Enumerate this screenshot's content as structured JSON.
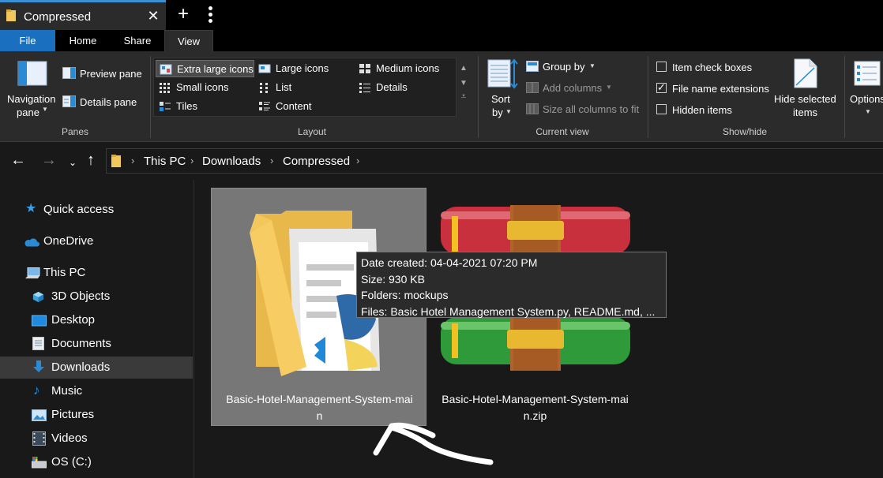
{
  "window": {
    "tab_title": "Compressed",
    "close_glyph": "✕",
    "new_tab_glyph": "+"
  },
  "ribbon_tabs": [
    "File",
    "Home",
    "Share",
    "View"
  ],
  "ribbon": {
    "panes": {
      "navigation_pane": "Navigation pane",
      "navigation_line1": "Navigation",
      "navigation_line2": "pane",
      "preview_pane": "Preview pane",
      "details_pane": "Details pane",
      "label": "Panes"
    },
    "layout": {
      "items": [
        "Extra large icons",
        "Large icons",
        "Medium icons",
        "Small icons",
        "List",
        "Details",
        "Tiles",
        "Content"
      ],
      "selected": "Extra large icons",
      "label": "Layout"
    },
    "current_view": {
      "sort_line1": "Sort",
      "sort_line2": "by",
      "group_by": "Group by",
      "add_columns": "Add columns",
      "size_all_columns": "Size all columns to fit",
      "label": "Current view"
    },
    "show_hide": {
      "item_check_boxes": "Item check boxes",
      "item_check_boxes_checked": false,
      "file_name_extensions": "File name extensions",
      "file_name_extensions_checked": true,
      "hidden_items": "Hidden items",
      "hidden_items_checked": false,
      "hide_selected_line1": "Hide selected",
      "hide_selected_line2": "items",
      "label": "Show/hide"
    },
    "options": {
      "label": "Options"
    }
  },
  "address": {
    "crumbs": [
      "This PC",
      "Downloads",
      "Compressed"
    ]
  },
  "sidebar": {
    "items": [
      {
        "label": "Quick access",
        "icon": "star-icon"
      },
      {
        "label": "OneDrive",
        "icon": "cloud-icon"
      },
      {
        "label": "This PC",
        "icon": "computer-icon"
      },
      {
        "label": "3D Objects",
        "icon": "cube-icon"
      },
      {
        "label": "Desktop",
        "icon": "desktop-icon"
      },
      {
        "label": "Documents",
        "icon": "documents-icon"
      },
      {
        "label": "Downloads",
        "icon": "download-icon"
      },
      {
        "label": "Music",
        "icon": "music-icon"
      },
      {
        "label": "Pictures",
        "icon": "pictures-icon"
      },
      {
        "label": "Videos",
        "icon": "videos-icon"
      },
      {
        "label": "OS (C:)",
        "icon": "drive-icon"
      }
    ],
    "selected": "Downloads"
  },
  "files": [
    {
      "line1": "Basic-Hotel-Management-System-mai",
      "line2": "n",
      "type": "folder",
      "selected": true
    },
    {
      "line1": "Basic-Hotel-Management-System-mai",
      "line2": "n.zip",
      "type": "winrar-archive",
      "selected": false
    }
  ],
  "tooltip": {
    "date_created": "Date created: 04-04-2021 07:20 PM",
    "size": "Size: 930 KB",
    "folders": "Folders: mockups",
    "files": "Files: Basic Hotel Management System.py, README.md, ..."
  },
  "colors": {
    "accent": "#1a6fbe",
    "folder": "#f2c75c",
    "archive_red": "#c8303e",
    "archive_green": "#2e9a3a",
    "archive_strap": "#b0642a"
  }
}
